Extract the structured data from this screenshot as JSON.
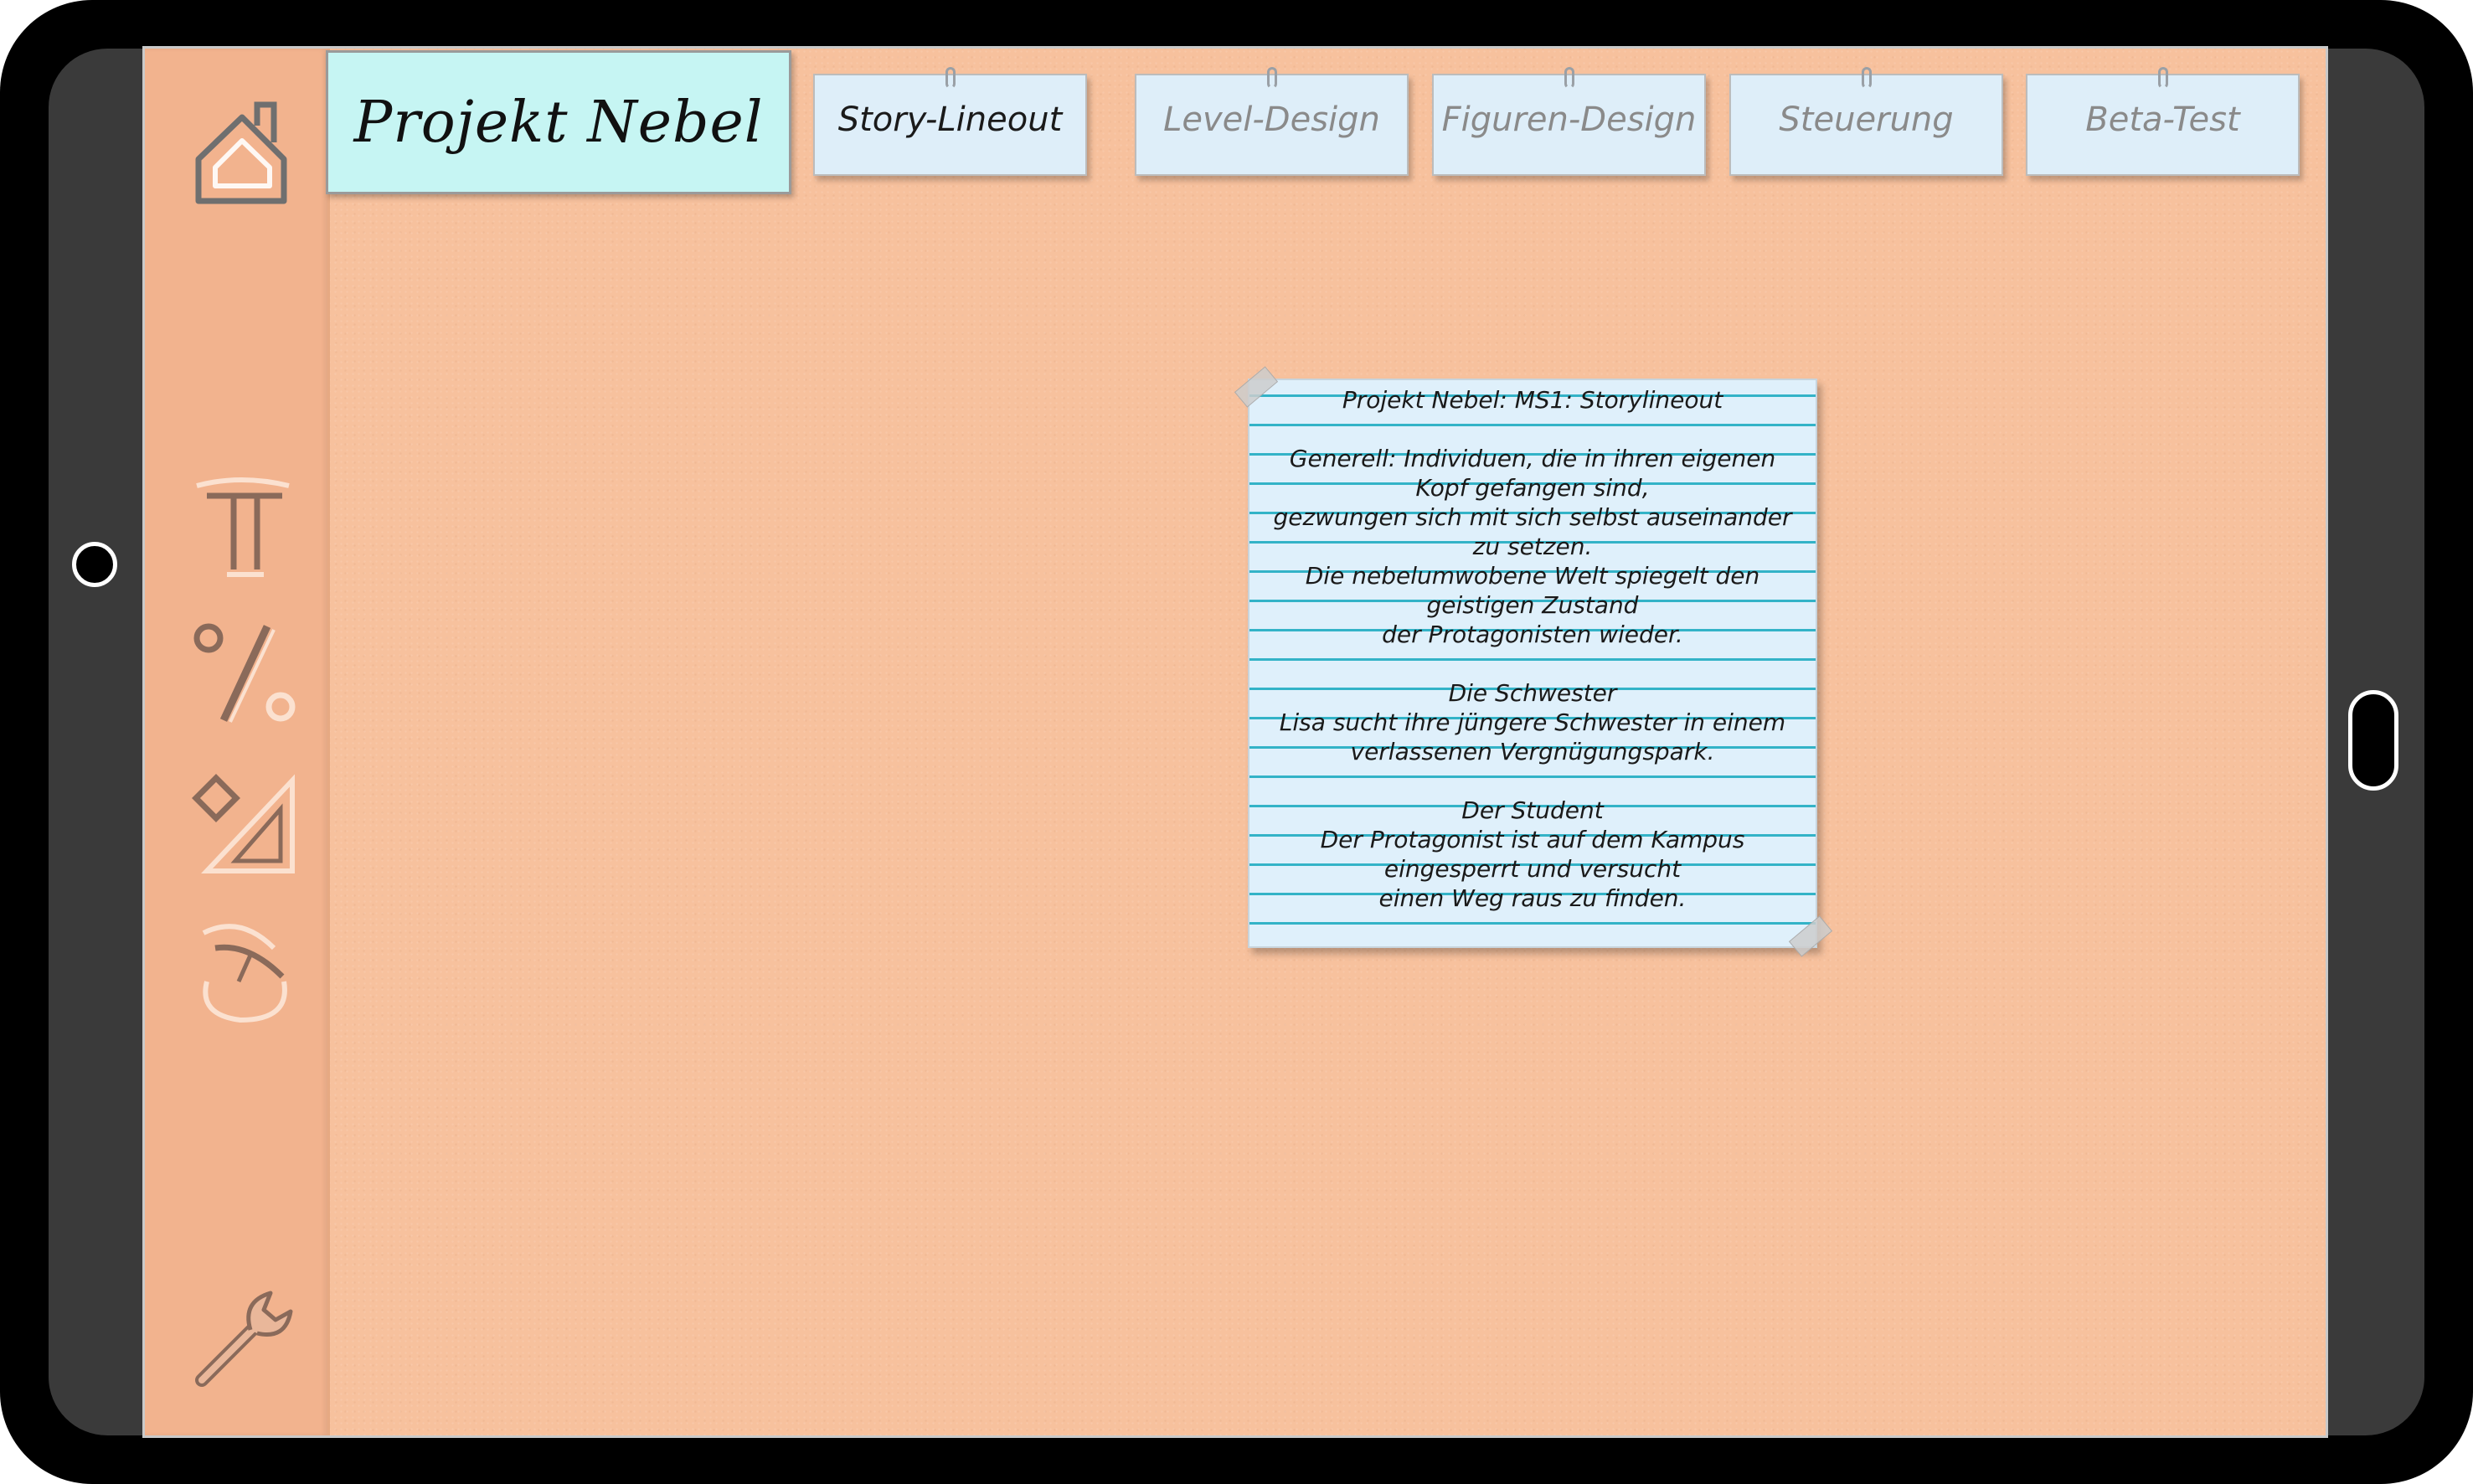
{
  "app": {
    "title": "Projekt Nebel"
  },
  "sidebar": {
    "items": [
      {
        "icon": "home-icon"
      },
      {
        "icon": "text-tool-icon"
      },
      {
        "icon": "percent-icon"
      },
      {
        "icon": "shape-ruler-icon"
      },
      {
        "icon": "drawing-tool-icon"
      },
      {
        "icon": "wrench-icon"
      }
    ]
  },
  "tabs": [
    {
      "label": "Story-Lineout",
      "active": true
    },
    {
      "label": "Level-Design",
      "active": false
    },
    {
      "label": "Figuren-Design",
      "active": false
    },
    {
      "label": "Steuerung",
      "active": false
    },
    {
      "label": "Beta-Test",
      "active": false
    }
  ],
  "note": {
    "lines": [
      "Projekt Nebel: MS1: Storylineout",
      "",
      "Generell: Individuen, die in ihren eigenen",
      "Kopf gefangen sind,",
      "gezwungen sich mit sich selbst auseinander",
      "zu setzen.",
      "Die nebelumwobene Welt spiegelt den",
      "geistigen Zustand",
      "der Protagonisten wieder.",
      "",
      "Die Schwester",
      "Lisa sucht ihre jüngere Schwester in einem",
      "verlassenen Vergnügungspark.",
      "",
      "Der Student",
      "Der Protagonist ist auf dem Kampus",
      "eingesperrt und versucht",
      "einen Weg raus zu finden."
    ]
  },
  "colors": {
    "background": "#f7c19d",
    "sidebar": "#f2b38e",
    "title_box": "#c6f5f3",
    "tab": "#deeef9",
    "note_paper": "#dff0fb",
    "note_rule": "#33b3c7"
  }
}
